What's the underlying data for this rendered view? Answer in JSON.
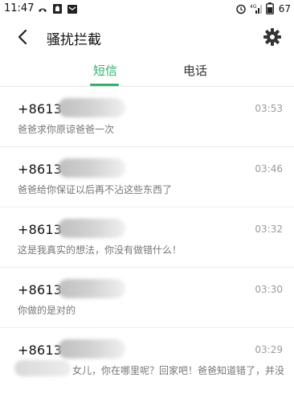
{
  "status_bar": {
    "time": "11:47",
    "signal_label": "4G",
    "battery": "67"
  },
  "header": {
    "title": "骚扰拦截"
  },
  "tabs": [
    {
      "label": "短信",
      "active": true
    },
    {
      "label": "电话",
      "active": false
    }
  ],
  "messages": [
    {
      "sender": "+8613",
      "time": "03:53",
      "preview": "爸爸求你原谅爸爸一次"
    },
    {
      "sender": "+8613",
      "time": "03:46",
      "preview": "爸爸给你保证以后再不沾这些东西了"
    },
    {
      "sender": "+8613",
      "time": "03:32",
      "preview": "这是我真实的想法，你没有做错什么！"
    },
    {
      "sender": "+8613",
      "time": "03:30",
      "preview": "你做的是对的"
    },
    {
      "sender": "+8613",
      "time": "03:29",
      "preview": "女儿，你在哪里呢？回家吧！爸爸知道错了，并没"
    }
  ],
  "colors": {
    "accent": "#2db36d"
  }
}
